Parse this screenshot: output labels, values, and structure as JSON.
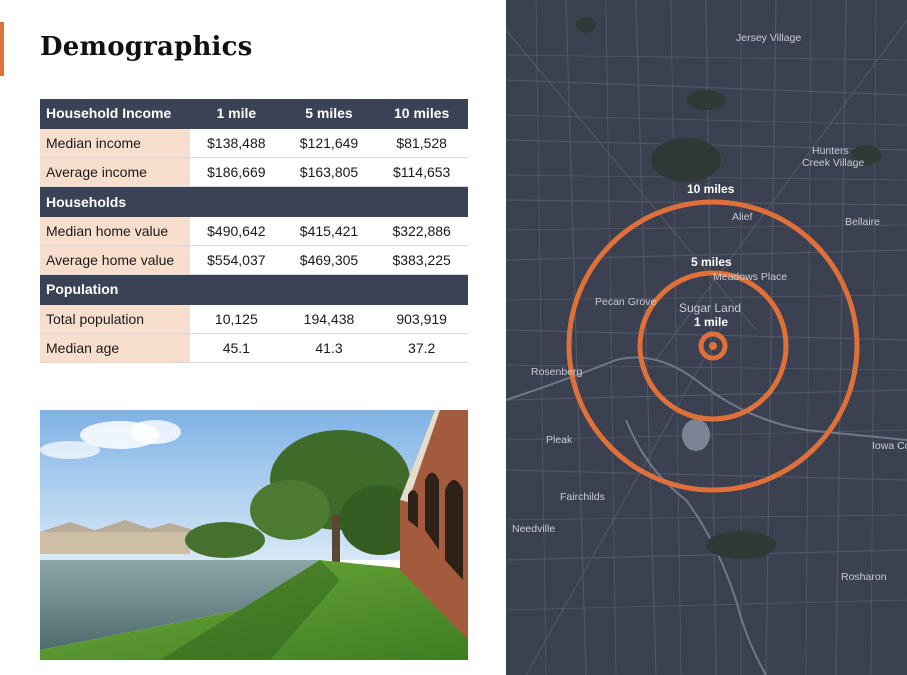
{
  "page": {
    "title": "Demographics",
    "accent_color": "#e0703a"
  },
  "table": {
    "header": [
      "Household Income",
      "1 mile",
      "5 miles",
      "10 miles"
    ],
    "income_rows": [
      {
        "label": "Median income",
        "values": [
          "$138,488",
          "$121,649",
          "$81,528"
        ]
      },
      {
        "label": "Average income",
        "values": [
          "$186,669",
          "$163,805",
          "$114,653"
        ]
      }
    ],
    "households_heading": "Households",
    "households_rows": [
      {
        "label": "Median home value",
        "values": [
          "$490,642",
          "$415,421",
          "$322,886"
        ]
      },
      {
        "label": "Average home value",
        "values": [
          "$554,037",
          "$469,305",
          "$383,225"
        ]
      }
    ],
    "population_heading": "Population",
    "population_rows": [
      {
        "label": "Total population",
        "values": [
          "10,125",
          "194,438",
          "903,919"
        ]
      },
      {
        "label": "Median age",
        "values": [
          "45.1",
          "41.3",
          "37.2"
        ]
      }
    ],
    "header_color": "#3a4255",
    "label_cell_color": "#f8dfcd"
  },
  "photo": {
    "subject": "lakeside building with lawn and trees"
  },
  "map": {
    "place_labels": [
      "Jersey Village",
      "Hunters",
      "Creek Village",
      "Bellaire",
      "Alief",
      "Meadows Place",
      "Pecan Grove",
      "Sugar Land",
      "Rosenberg",
      "Pleak",
      "Fairchilds",
      "Needville",
      "Iowa Co",
      "Rosharon"
    ],
    "ring_labels": [
      "10 miles",
      "5 miles",
      "1 mile"
    ],
    "ring_color": "#e0703a",
    "background_color": "#3b4150"
  }
}
